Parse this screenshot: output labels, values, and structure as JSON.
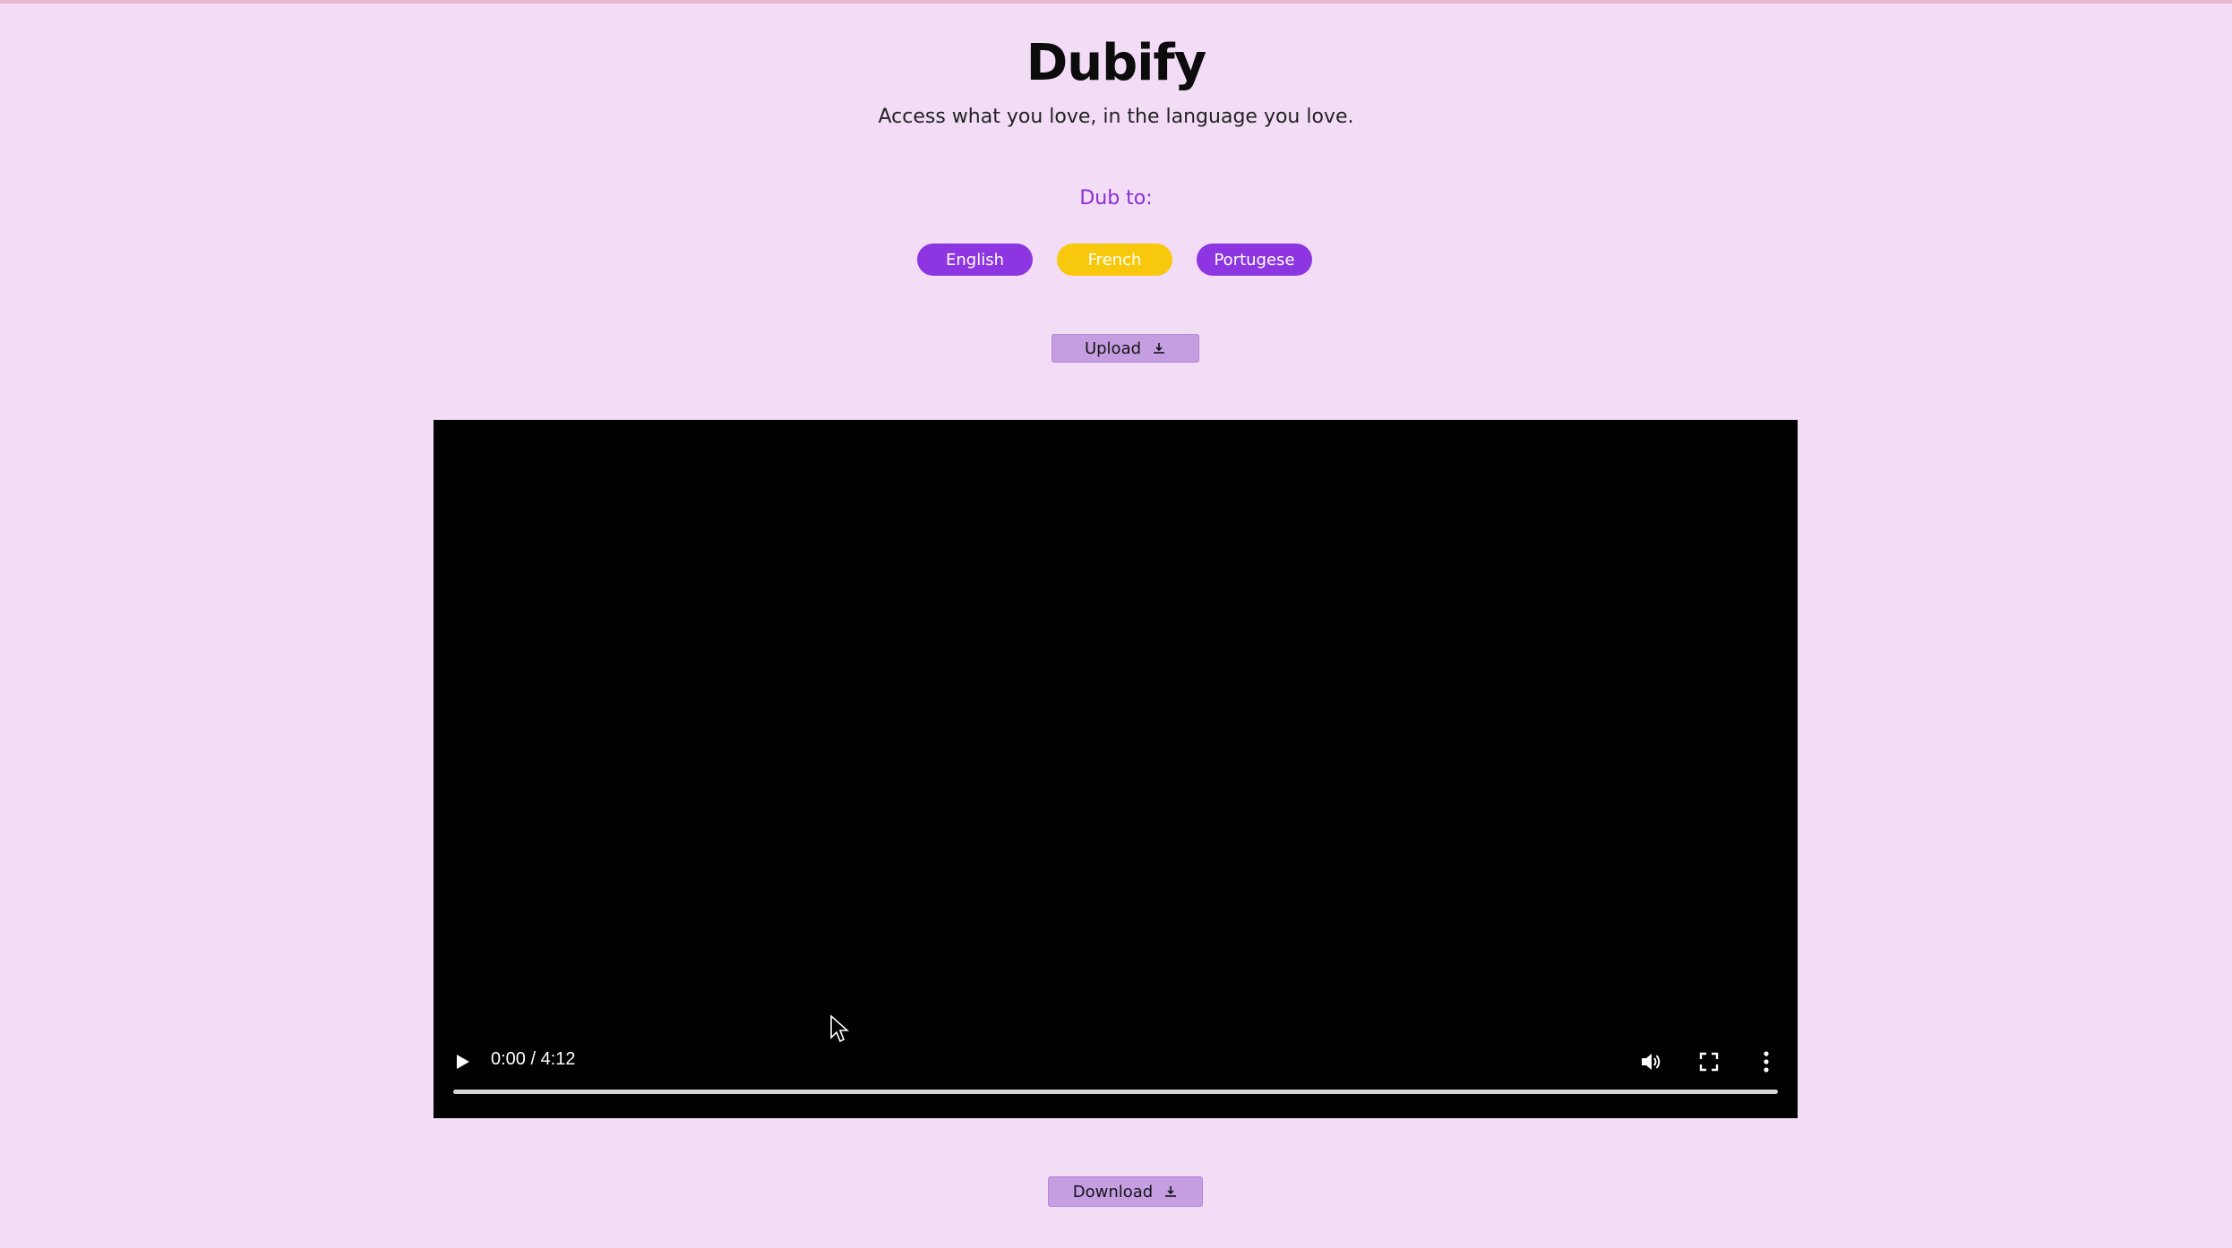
{
  "app": {
    "title": "Dubify",
    "tagline": "Access what you love, in the language you love."
  },
  "dub": {
    "label": "Dub to:",
    "languages": [
      {
        "label": "English",
        "color": "#8d35e0",
        "selected": false
      },
      {
        "label": "French",
        "color": "#f7c80c",
        "selected": true
      },
      {
        "label": "Portugese",
        "color": "#8d35e0",
        "selected": false
      }
    ]
  },
  "upload": {
    "label": "Upload",
    "icon": "upload-icon"
  },
  "player": {
    "time": "0:00 / 4:12",
    "progress_fraction": 0,
    "icons": [
      "play-icon",
      "volume-icon",
      "fullscreen-icon",
      "more-options-icon"
    ]
  },
  "download": {
    "label": "Download",
    "icon": "download-icon"
  },
  "colors": {
    "background": "#f2dcf6",
    "accent": "#8d35e0",
    "selected": "#f7c80c",
    "button": "#c59ee2"
  }
}
